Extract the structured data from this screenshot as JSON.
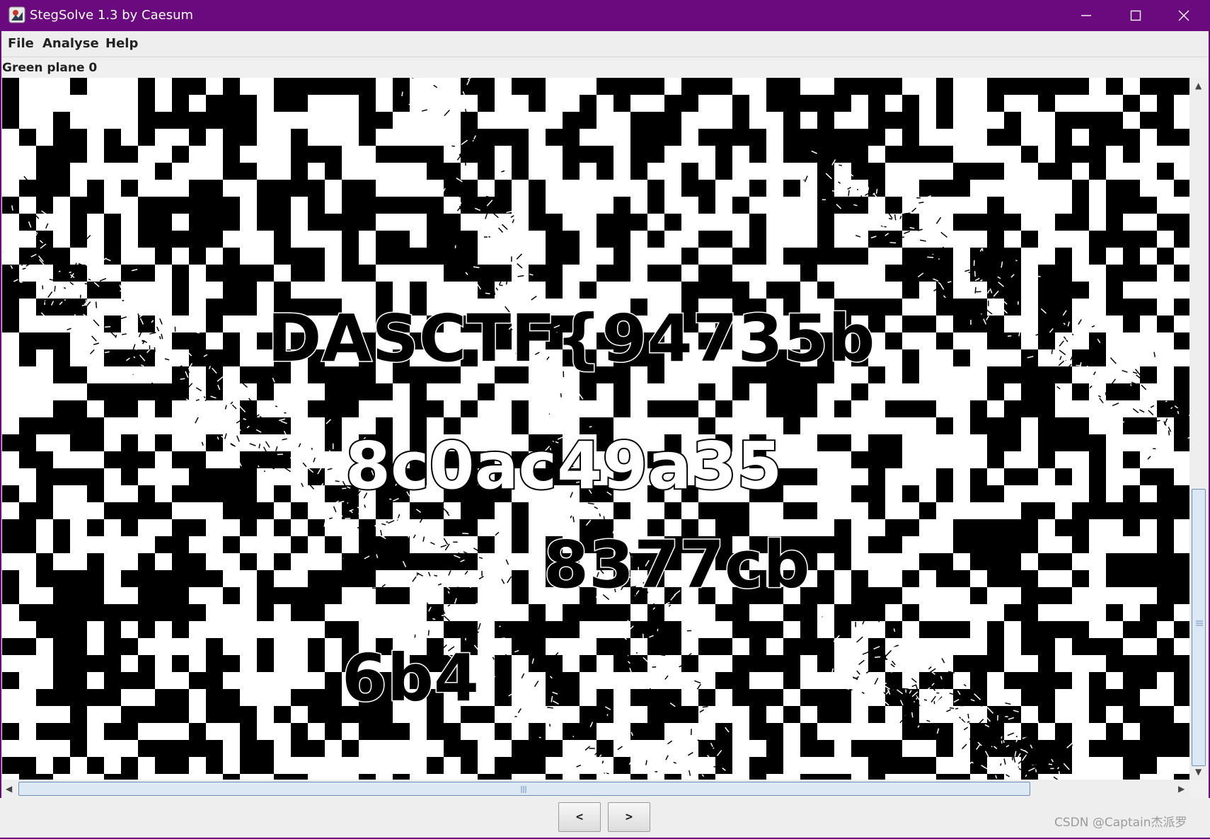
{
  "window": {
    "title": "StegSolve 1.3 by Caesum",
    "minimize_icon": "minimize-icon",
    "maximize_icon": "maximize-icon",
    "close_icon": "close-icon",
    "frame_color": "#6a0a7e"
  },
  "menu": {
    "items": [
      {
        "label": "File"
      },
      {
        "label": "Analyse"
      },
      {
        "label": "Help"
      }
    ]
  },
  "plane_label": "Green plane 0",
  "image": {
    "description_colors": [
      "#000000",
      "#ffffff"
    ],
    "hidden_text_lines": [
      "DASCTF{94735b",
      "8c0ac49a35",
      "8377cb",
      "6b4"
    ]
  },
  "navigation": {
    "prev_label": "<",
    "next_label": ">"
  },
  "watermark": "CSDN @Captain杰派罗"
}
